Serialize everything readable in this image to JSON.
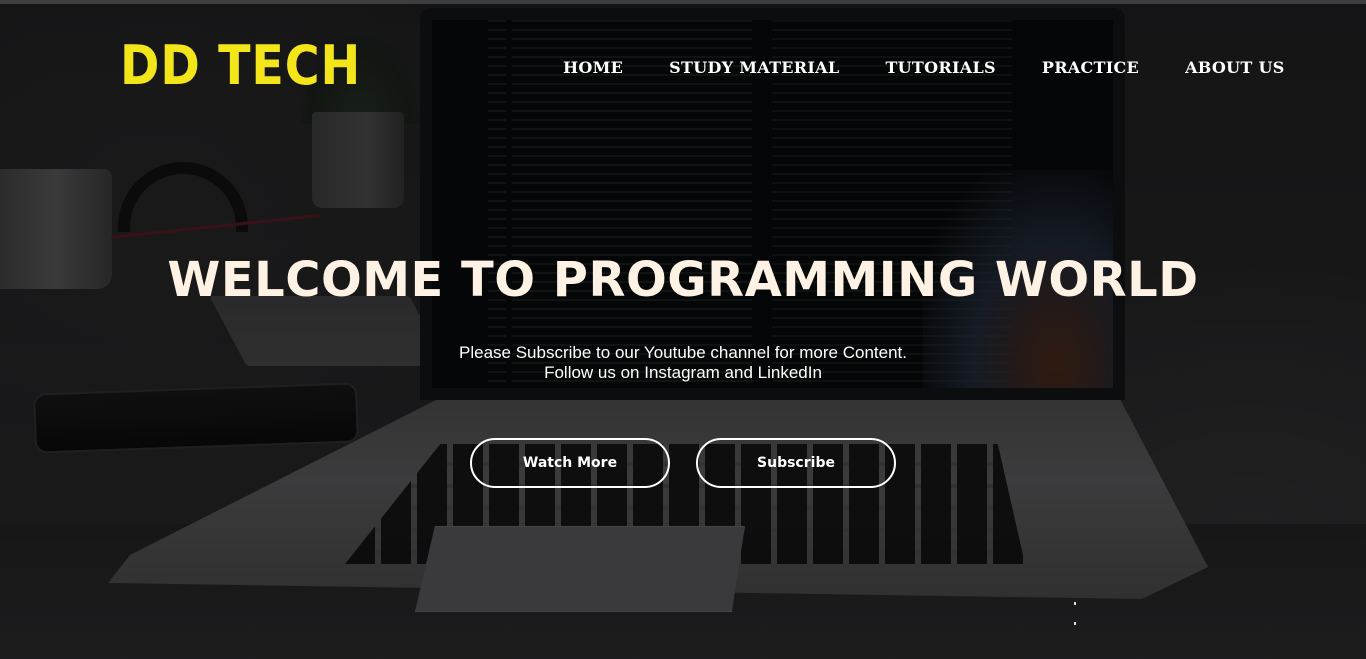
{
  "brand": {
    "logo_text": "DD TECH",
    "logo_color": "#f2e51a"
  },
  "nav": {
    "items": [
      "HOME",
      "STUDY MATERIAL",
      "TUTORIALS",
      "PRACTICE",
      "ABOUT US"
    ]
  },
  "hero": {
    "title": "WELCOME TO PROGRAMMING WORLD",
    "subtitle_line1": "Please Subscribe to our Youtube channel for more Content.",
    "subtitle_line2": "Follow us on Instagram and LinkedIn",
    "title_color": "#fdf2e4"
  },
  "buttons": {
    "watch_more": "Watch More",
    "subscribe": "Subscribe"
  },
  "background": {
    "description_icon": "laptop-with-code-photo"
  }
}
